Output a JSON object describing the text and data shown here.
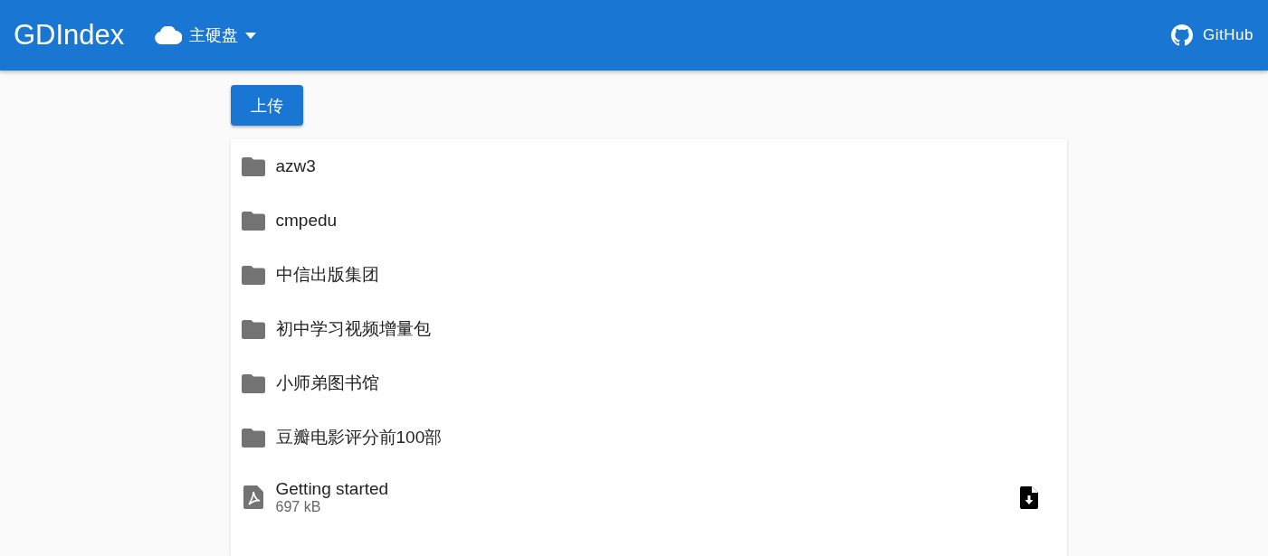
{
  "app_bar": {
    "title": "GDIndex",
    "drive": "主硬盘",
    "github": "GitHub"
  },
  "upload_button": "上传",
  "items": [
    {
      "kind": "folder",
      "name": "azw3"
    },
    {
      "kind": "folder",
      "name": "cmpedu"
    },
    {
      "kind": "folder",
      "name": "中信出版集团"
    },
    {
      "kind": "folder",
      "name": "初中学习视频增量包"
    },
    {
      "kind": "folder",
      "name": "小师弟图书馆"
    },
    {
      "kind": "folder",
      "name": "豆瓣电影评分前100部"
    },
    {
      "kind": "pdf",
      "name": "Getting started",
      "size": "697 kB"
    }
  ]
}
